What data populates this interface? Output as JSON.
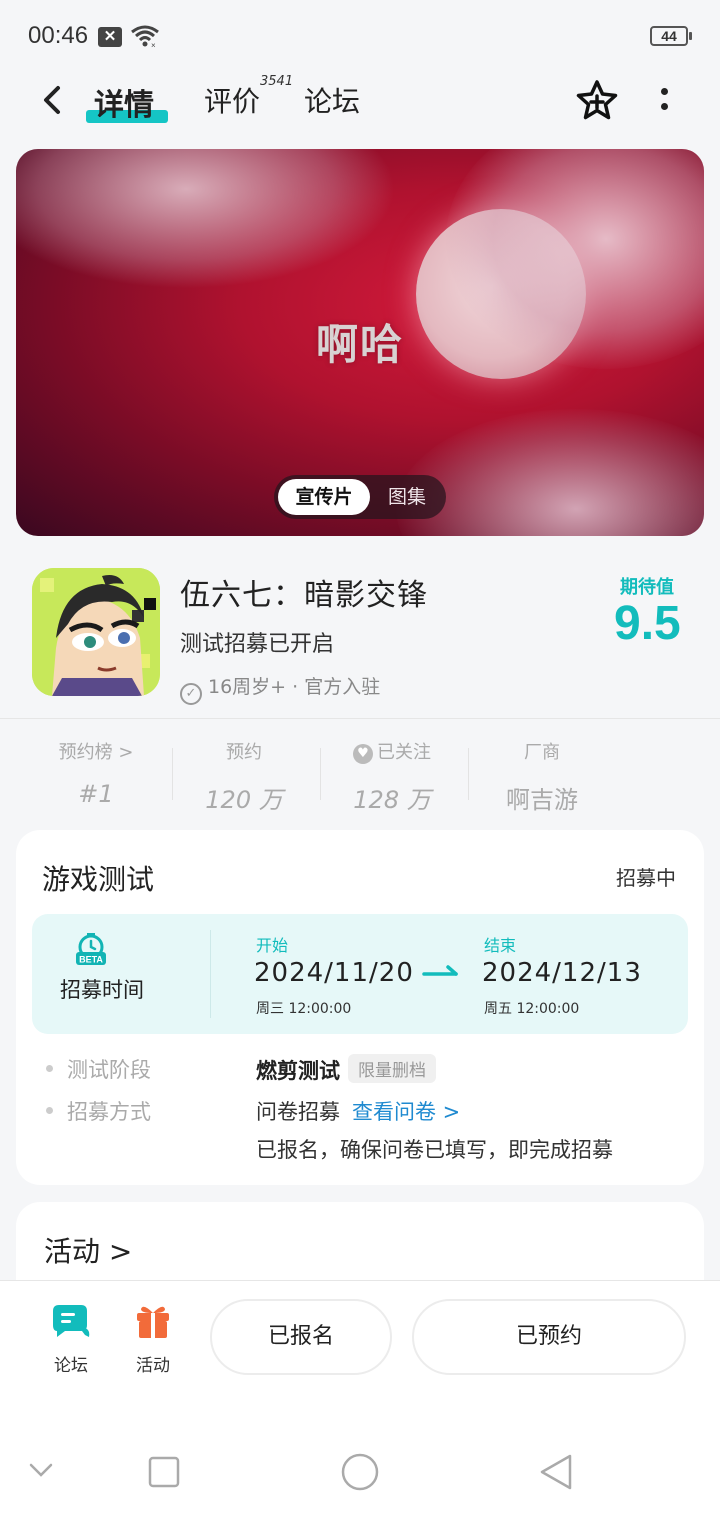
{
  "status_bar": {
    "time": "00:46",
    "notif_badge": "✕",
    "battery": "44"
  },
  "nav": {
    "tabs": [
      {
        "label": "详情"
      },
      {
        "label": "评价"
      },
      {
        "label": "论坛"
      }
    ],
    "review_count": "3541",
    "accent_color": "#15c5c5"
  },
  "banner": {
    "title": "啊哈",
    "toggle": {
      "active": "宣传片",
      "inactive": "图集"
    }
  },
  "game": {
    "name": "伍六七：暗影交锋",
    "status": "测试招募已开启",
    "tags": "16周岁+ · 官方入驻",
    "expect_label": "期待值",
    "expect_score": "9.5"
  },
  "stats": [
    {
      "label": "预约榜 >",
      "value": "#1"
    },
    {
      "label": "预约",
      "value": "120 万"
    },
    {
      "label": "已关注",
      "value": "128 万"
    },
    {
      "label": "厂商",
      "value": "啊吉游"
    }
  ],
  "test": {
    "title": "游戏测试",
    "status": "招募中",
    "recruit_label": "招募时间",
    "beta_badge": "BETA",
    "start_label": "开始",
    "start_date": "2024/11/20",
    "start_time": "周三  12:00:00",
    "end_label": "结束",
    "end_date": "2024/12/13",
    "end_time": "周五  12:00:00",
    "phase_key": "测试阶段",
    "phase_value": "燃剪测试",
    "phase_tag": "限量删档",
    "method_key": "招募方式",
    "method_value": "问卷招募",
    "method_link": "查看问卷 >",
    "method_note": "已报名，确保问卷已填写，即完成招募"
  },
  "activity": {
    "title": "活动 >"
  },
  "bottom": {
    "forum_label": "论坛",
    "activity_label": "活动",
    "signed_label": "已报名",
    "reserved_label": "已预约"
  }
}
